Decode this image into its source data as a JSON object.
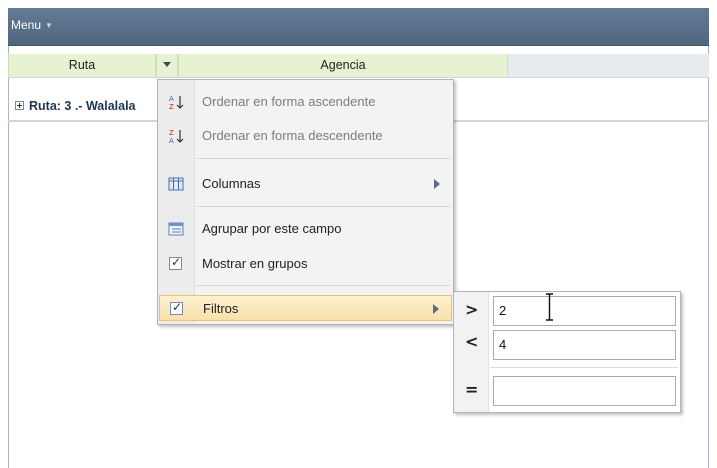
{
  "menubar": {
    "menu_label": "Menu"
  },
  "grid": {
    "columns": [
      "Ruta",
      "Agencia"
    ],
    "group_row_text": "Ruta: 3 .- Walalala"
  },
  "context_menu": {
    "items": [
      {
        "label": "Ordenar en forma ascendente",
        "icon": "sort-ascending-icon",
        "enabled": false
      },
      {
        "label": "Ordenar en forma descendente",
        "icon": "sort-descending-icon",
        "enabled": false
      },
      {
        "label": "Columnas",
        "icon": "columns-icon",
        "has_submenu": true
      },
      {
        "label": "Agrupar por este campo",
        "icon": "group-by-icon"
      },
      {
        "label": "Mostrar en grupos",
        "icon": "checkbox-icon",
        "checked": true
      },
      {
        "label": "Filtros",
        "icon": "checkbox-icon",
        "checked": true,
        "has_submenu": true,
        "active": true
      }
    ]
  },
  "filter_submenu": {
    "greater_than": {
      "operator": ">",
      "value": "2"
    },
    "less_than": {
      "operator": "<",
      "value": "4"
    },
    "equals": {
      "operator": "=",
      "value": ""
    }
  },
  "colors": {
    "menubar": "#55708f",
    "header_col": "#e6f2d2",
    "active_item": "#fbe8bb"
  }
}
